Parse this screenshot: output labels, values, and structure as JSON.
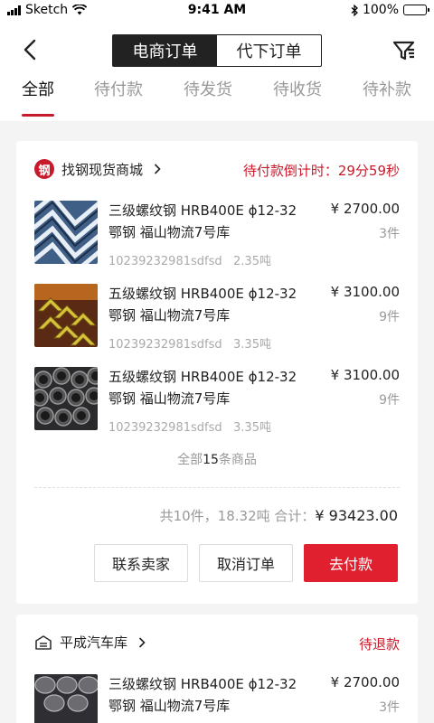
{
  "status_bar": {
    "carrier": "Sketch",
    "time": "9:41 AM",
    "battery": "100%",
    "battery_level": 1.0
  },
  "nav": {
    "segments": [
      "电商订单",
      "代下订单"
    ],
    "active_segment": 0
  },
  "tabs": [
    "全部",
    "待付款",
    "待发货",
    "待收货",
    "待补款"
  ],
  "active_tab": 0,
  "orders": [
    {
      "store_name": "找钢现货商城",
      "store_logo_char": "钢",
      "status": "待付款倒计时：29分59秒",
      "products": [
        {
          "name_line1": "三级螺纹钢 HRB400E ϕ12-32",
          "name_line2": "鄂钢 福山物流7号库",
          "code": "10239232981sdfsd",
          "weight": "2.35吨",
          "price": "¥ 2700.00",
          "qty": "3件",
          "image": "rebar-steel"
        },
        {
          "name_line1": "五级螺纹钢 HRB400E ϕ12-32",
          "name_line2": "鄂钢 福山物流7号库",
          "code": "10239232981sdfsd",
          "weight": "3.35吨",
          "price": "¥ 3100.00",
          "qty": "9件",
          "image": "angle-steel"
        },
        {
          "name_line1": "五级螺纹钢 HRB400E ϕ12-32",
          "name_line2": "鄂钢 福山物流7号库",
          "code": "10239232981sdfsd",
          "weight": "3.35吨",
          "price": "¥ 3100.00",
          "qty": "9件",
          "image": "steel-pipe"
        }
      ],
      "all_count_prefix": "全部",
      "all_count_num": "15",
      "all_count_suffix": "条商品",
      "summary_text": "共10件，18.32吨  合计：",
      "summary_total": "¥ 93423.00",
      "buttons": [
        "联系卖家",
        "取消订单",
        "去付款"
      ]
    },
    {
      "store_name": "平成汽车库",
      "status": "待退款",
      "products": [
        {
          "name_line1": "三级螺纹钢 HRB400E ϕ12-32",
          "name_line2": "鄂钢 福山物流7号库",
          "price": "¥ 2700.00",
          "qty": "3件",
          "image": "steel-coil"
        }
      ]
    }
  ],
  "colors": {
    "accent": "#c81a2b",
    "primary_button": "#e0202f",
    "dark": "#222222",
    "muted": "#999999"
  }
}
